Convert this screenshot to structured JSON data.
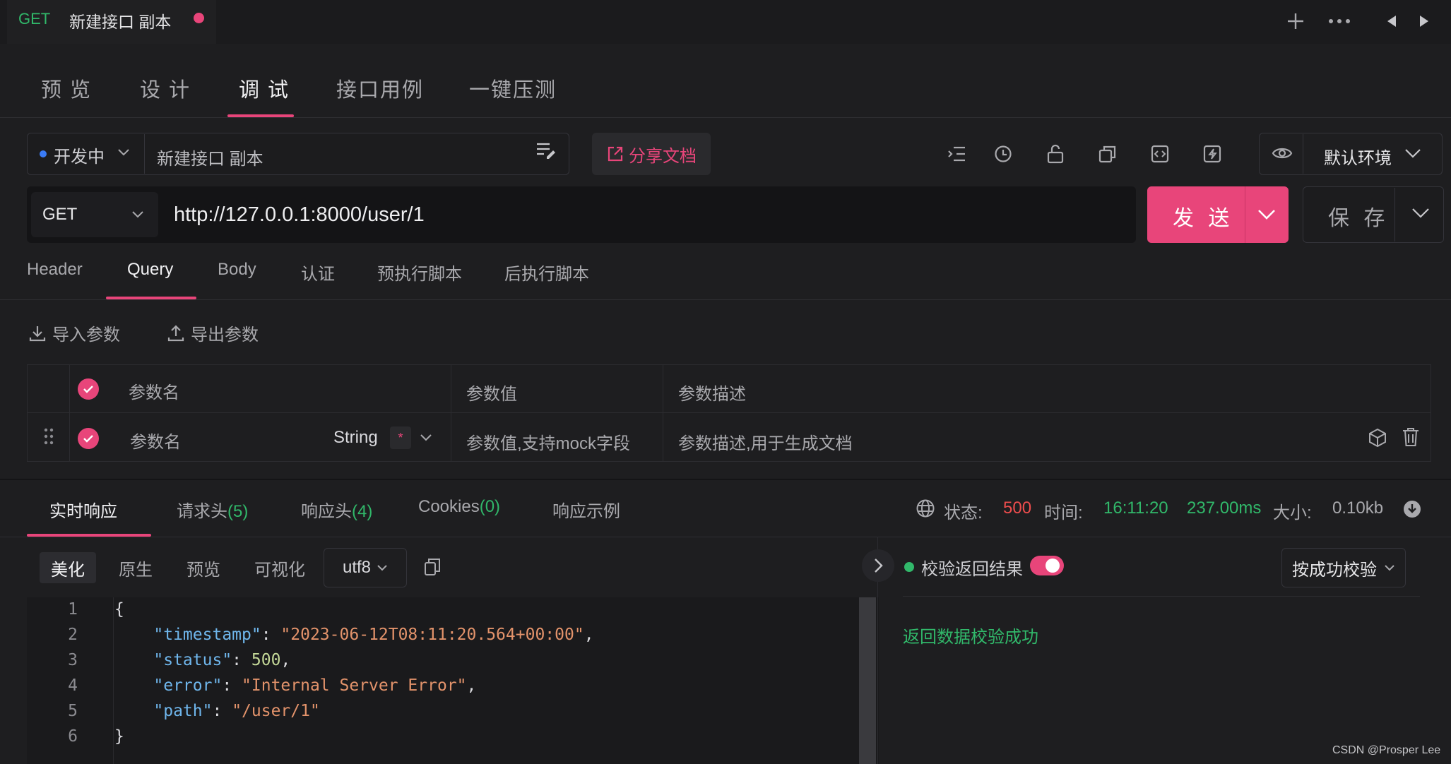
{
  "colors": {
    "accent": "#e8457a",
    "success": "#31b86a",
    "error": "#ee4d4d",
    "background": "#1e1e20"
  },
  "top_tab": {
    "method": "GET",
    "title": "新建接口 副本"
  },
  "top_icons": [
    "plus-icon",
    "more-icon",
    "arrow-left-icon",
    "arrow-right-icon"
  ],
  "nav_tabs": [
    "预 览",
    "设 计",
    "调 试",
    "接口用例",
    "一键压测"
  ],
  "nav_active": "调 试",
  "toolbar": {
    "status": "开发中",
    "api_name": "新建接口 副本",
    "share_label": "分享文档",
    "environment": "默认环境"
  },
  "request": {
    "method": "GET",
    "url": "http://127.0.0.1:8000/user/1",
    "send_label": "发 送",
    "save_label": "保 存"
  },
  "req_tabs": [
    "Header",
    "Query",
    "Body",
    "认证",
    "预执行脚本",
    "后执行脚本"
  ],
  "req_active": "Query",
  "params_actions": {
    "import": "导入参数",
    "export": "导出参数"
  },
  "params_table": {
    "headers": [
      "参数名",
      "参数值",
      "参数描述"
    ],
    "row": {
      "name_placeholder": "参数名",
      "type": "String",
      "required_mark": "*",
      "value_placeholder": "参数值,支持mock字段",
      "desc_placeholder": "参数描述,用于生成文档"
    }
  },
  "response": {
    "tabs": [
      {
        "label": "实时响应",
        "count": ""
      },
      {
        "label": "请求头",
        "count": "(5)"
      },
      {
        "label": "响应头",
        "count": "(4)"
      },
      {
        "label": "Cookies",
        "count": "(0)"
      },
      {
        "label": "响应示例",
        "count": ""
      }
    ],
    "status_label": "状态:",
    "status_value": "500",
    "time_label": "时间:",
    "time_value": "16:11:20",
    "duration": "237.00ms",
    "size_label": "大小:",
    "size_value": "0.10kb",
    "views": [
      "美化",
      "原生",
      "预览",
      "可视化"
    ],
    "encoding": "utf8",
    "code_lines": [
      {
        "n": "1",
        "indent": "",
        "key": "",
        "value": "",
        "punct": "{",
        "vtype": ""
      },
      {
        "n": "2",
        "indent": "    ",
        "key": "\"timestamp\"",
        "value": "\"2023-06-12T08:11:20.564+00:00\"",
        "punct": ",",
        "vtype": "s"
      },
      {
        "n": "3",
        "indent": "    ",
        "key": "\"status\"",
        "value": "500",
        "punct": ",",
        "vtype": "n"
      },
      {
        "n": "4",
        "indent": "    ",
        "key": "\"error\"",
        "value": "\"Internal Server Error\"",
        "punct": ",",
        "vtype": "s"
      },
      {
        "n": "5",
        "indent": "    ",
        "key": "\"path\"",
        "value": "\"/user/1\"",
        "punct": "",
        "vtype": "s"
      },
      {
        "n": "6",
        "indent": "",
        "key": "",
        "value": "",
        "punct": "}",
        "vtype": ""
      }
    ],
    "validate_label": "校验返回结果",
    "validate_enabled": true,
    "validate_mode": "按成功校验",
    "validate_result": "返回数据校验成功"
  },
  "watermark": "CSDN @Prosper Lee"
}
